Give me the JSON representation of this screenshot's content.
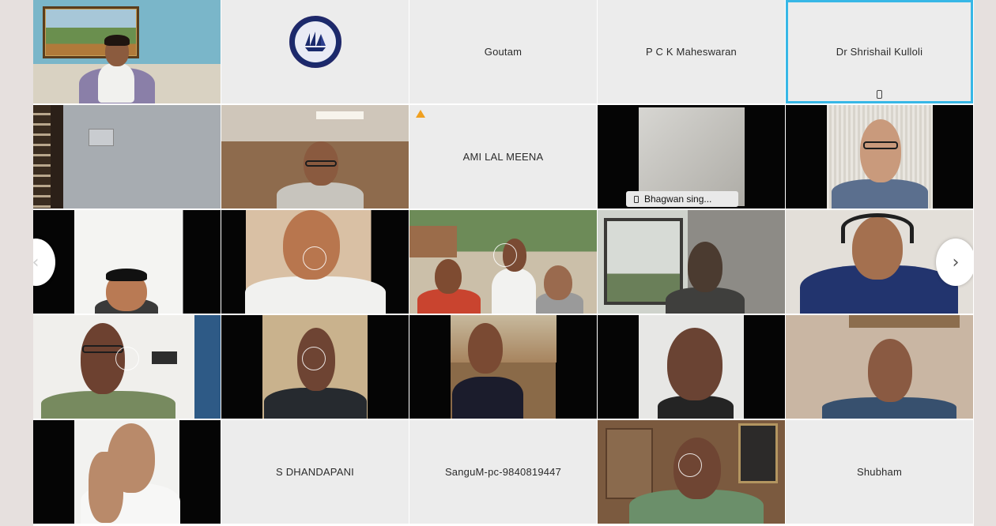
{
  "participants": [
    {
      "name": "",
      "kind": "video"
    },
    {
      "name": "",
      "kind": "logo"
    },
    {
      "name": "Goutam",
      "kind": "name"
    },
    {
      "name": "P C K Maheswaran",
      "kind": "name"
    },
    {
      "name": "Dr Shrishail Kulloli",
      "kind": "name",
      "active": true,
      "device": "phone-icon"
    },
    {
      "name": "",
      "kind": "video"
    },
    {
      "name": "",
      "kind": "video"
    },
    {
      "name": "AMI LAL MEENA",
      "kind": "name",
      "status": "warning-icon"
    },
    {
      "name": "Bhagwan sing...",
      "kind": "video",
      "active": true,
      "device": "phone-icon"
    },
    {
      "name": "",
      "kind": "video"
    },
    {
      "name": "",
      "kind": "video"
    },
    {
      "name": "",
      "kind": "video"
    },
    {
      "name": "",
      "kind": "video"
    },
    {
      "name": "",
      "kind": "video"
    },
    {
      "name": "",
      "kind": "video"
    },
    {
      "name": "",
      "kind": "video"
    },
    {
      "name": "",
      "kind": "video"
    },
    {
      "name": "",
      "kind": "video"
    },
    {
      "name": "",
      "kind": "video"
    },
    {
      "name": "",
      "kind": "video"
    },
    {
      "name": "",
      "kind": "video"
    },
    {
      "name": "S DHANDAPANI",
      "kind": "name"
    },
    {
      "name": "SanguM-pc-9840819447",
      "kind": "name"
    },
    {
      "name": "",
      "kind": "video"
    },
    {
      "name": "Shubham",
      "kind": "name"
    }
  ],
  "navigation": {
    "prev_icon": "chevron-left-icon",
    "next_icon": "chevron-right-icon",
    "next_glyph": "›",
    "prev_glyph": "‹"
  },
  "colors": {
    "active_border": "#37b7e6",
    "tile_background": "#ececec",
    "page_background": "#e6e0de",
    "warning": "#f0a020"
  }
}
